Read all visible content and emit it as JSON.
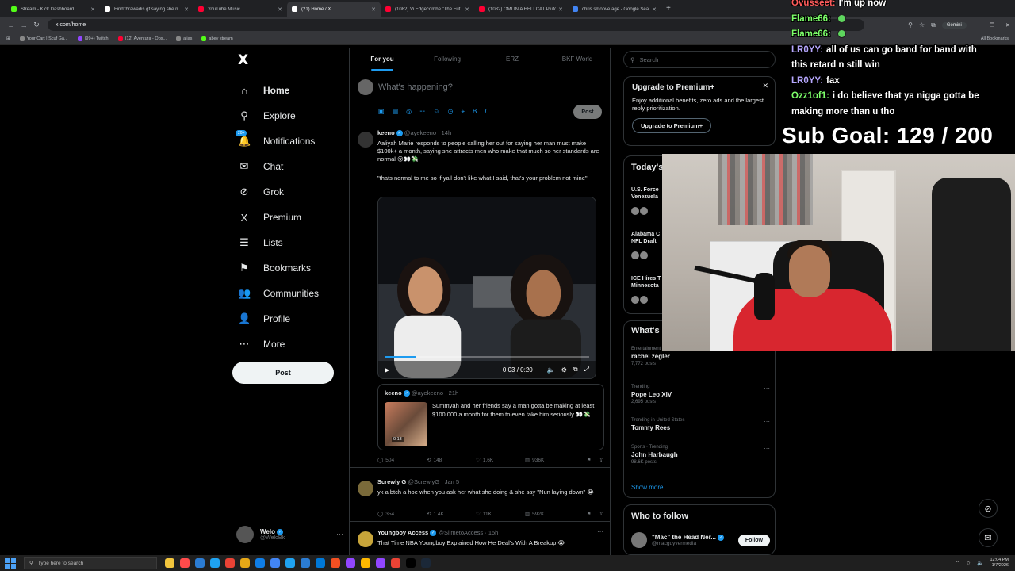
{
  "browser": {
    "tabs": [
      {
        "title": "Stream - Kick Dashboard",
        "color": "#53fc18",
        "active": false
      },
      {
        "title": "Find 'brawadis gf saying she n...",
        "color": "#ffffff",
        "active": false
      },
      {
        "title": "YouTube Music",
        "color": "#ff0033",
        "active": false
      },
      {
        "title": "(21) Home / X",
        "color": "#ffffff",
        "active": true
      },
      {
        "title": "(1082) Vi Edgecombe \"The Fut...",
        "color": "#ff0033",
        "active": false
      },
      {
        "title": "(1082) OMI IN A HELLCAT Pluto...",
        "color": "#ff0033",
        "active": false
      },
      {
        "title": "chris smoove age - Google Sea...",
        "color": "#4285f4",
        "active": false
      }
    ],
    "new_tab": "+",
    "url": "x.com/home",
    "gemini_label": "Gemini",
    "bookmarks": [
      {
        "label": "Your Cart | Scuf Ga...",
        "color": "#888888"
      },
      {
        "label": "(99+) Twitch",
        "color": "#9146ff"
      },
      {
        "label": "(12) Aventura - Obs...",
        "color": "#ff0033"
      },
      {
        "label": "alias",
        "color": "#888888"
      },
      {
        "label": "abey stream",
        "color": "#53fc18"
      }
    ],
    "all_bookmarks": "All Bookmarks"
  },
  "sidebar": {
    "logo": "X",
    "notif_badge": "20+",
    "items": [
      {
        "label": "Home",
        "icon": "⌂",
        "bold": true
      },
      {
        "label": "Explore",
        "icon": "⚲"
      },
      {
        "label": "Notifications",
        "icon": "🔔"
      },
      {
        "label": "Chat",
        "icon": "✉"
      },
      {
        "label": "Grok",
        "icon": "⊘"
      },
      {
        "label": "Premium",
        "icon": "X"
      },
      {
        "label": "Lists",
        "icon": "☰"
      },
      {
        "label": "Bookmarks",
        "icon": "⚑"
      },
      {
        "label": "Communities",
        "icon": "👥"
      },
      {
        "label": "Profile",
        "icon": "👤"
      },
      {
        "label": "More",
        "icon": "⋯"
      }
    ],
    "post_button": "Post",
    "account": {
      "name": "Welo",
      "handle": "@WeloBk"
    }
  },
  "main": {
    "tabs": [
      "For you",
      "Following",
      "ERZ",
      "BKF World"
    ],
    "composer_placeholder": "What's happening?",
    "composer_post": "Post",
    "tweet1": {
      "name": "keeno",
      "handle": "@ayekeeno · 14h",
      "text1": "Aaliyah Marie responds to people calling her out for saying her man must make $100k+ a month, saying she attracts men who make that much so her standards are normal 😮👀💸",
      "text2": "\"thats normal to me so if yall don't like what I said, that's your problem not mine\"",
      "video_time": "0:03 / 0:20",
      "video_progress": 0.15,
      "quote": {
        "name": "keeno",
        "handle": "@ayekeeno · 21h",
        "text": "Summyah and her friends say a man gotta be making at least $100,000 a month for them to even take him seriously 👀💸",
        "duration": "0:13"
      },
      "replies": "504",
      "reposts": "148",
      "likes": "1.6K",
      "views": "936K"
    },
    "tweet2": {
      "name": "Screwly G",
      "handle": "@ScrewlyG · Jan 5",
      "text": "yk a btch a hoe when you ask her what she doing & she say \"Nun laying down\" 😭",
      "replies": "354",
      "reposts": "1.4K",
      "likes": "11K",
      "views": "592K"
    },
    "tweet3": {
      "name": "Youngboy Access",
      "handle": "@SlimetoAccess · 15h",
      "text": "That Time NBA Youngboy Explained How He Deal's With A Breakup 😭"
    }
  },
  "right": {
    "search_placeholder": "Search",
    "premium": {
      "title": "Upgrade to Premium+",
      "desc": "Enjoy additional benefits, zero ads and the largest reply prioritization.",
      "button": "Upgrade to Premium+"
    },
    "today_title": "Today's",
    "today_items": [
      "U.S. Force Venezuela",
      "Alabama C NFL Draft",
      "ICE Hires T Minnesota"
    ],
    "whats_title": "What's",
    "trends": [
      {
        "ctx": "Entertainment",
        "name": "rachel zegler",
        "count": "7,772 posts"
      },
      {
        "ctx": "Trending",
        "name": "Pope Leo XIV",
        "count": "2,695 posts"
      },
      {
        "ctx": "Trending in United States",
        "name": "Tommy Rees",
        "count": ""
      },
      {
        "ctx": "Sports · Trending",
        "name": "John Harbaugh",
        "count": "98.6K posts"
      }
    ],
    "show_more": "Show more",
    "who_to_follow": "Who to follow",
    "follow_suggestion": {
      "name": "\"Mac\" the Head Ner...",
      "handle": "@macguyvermedia",
      "button": "Follow"
    }
  },
  "stream": {
    "chat": [
      {
        "user": "Ovusseet:",
        "msg": "I'm up now",
        "color": "#ff5c5c",
        "emote": false
      },
      {
        "user": "Flame66:",
        "msg": "",
        "color": "#7dff6a",
        "emote": true
      },
      {
        "user": "Flame66:",
        "msg": "",
        "color": "#7dff6a",
        "emote": true
      },
      {
        "user": "LR0YY:",
        "msg": "all of us can go band for band with",
        "color": "#b7a8ff",
        "emote": false
      },
      {
        "user": "",
        "msg": "this retard n still win",
        "color": "#ffffff",
        "emote": false
      },
      {
        "user": "LR0YY:",
        "msg": "fax",
        "color": "#b7a8ff",
        "emote": false
      },
      {
        "user": "Ozz1of1:",
        "msg": "i do believe that ya nigga gotta be",
        "color": "#7dff6a",
        "emote": false
      },
      {
        "user": "",
        "msg": "making more than u tho",
        "color": "#ffffff",
        "emote": false
      }
    ],
    "sub_goal": "Sub Goal:  129 / 200"
  },
  "taskbar": {
    "search_placeholder": "Type here to search",
    "time": "12:04 PM",
    "date": "1/7/2026",
    "app_colors": [
      "#f2c53d",
      "#ff4b4b",
      "#2b7cd3",
      "#1fa3f2",
      "#ea4335",
      "#e6a817",
      "#0f7ee8",
      "#4285f4",
      "#1fa3f2",
      "#2b7cd3",
      "#0078d7",
      "#f25022",
      "#9146ff",
      "#ffb900",
      "#9146ff",
      "#ea4335",
      "#000000",
      "#1b2838"
    ]
  }
}
